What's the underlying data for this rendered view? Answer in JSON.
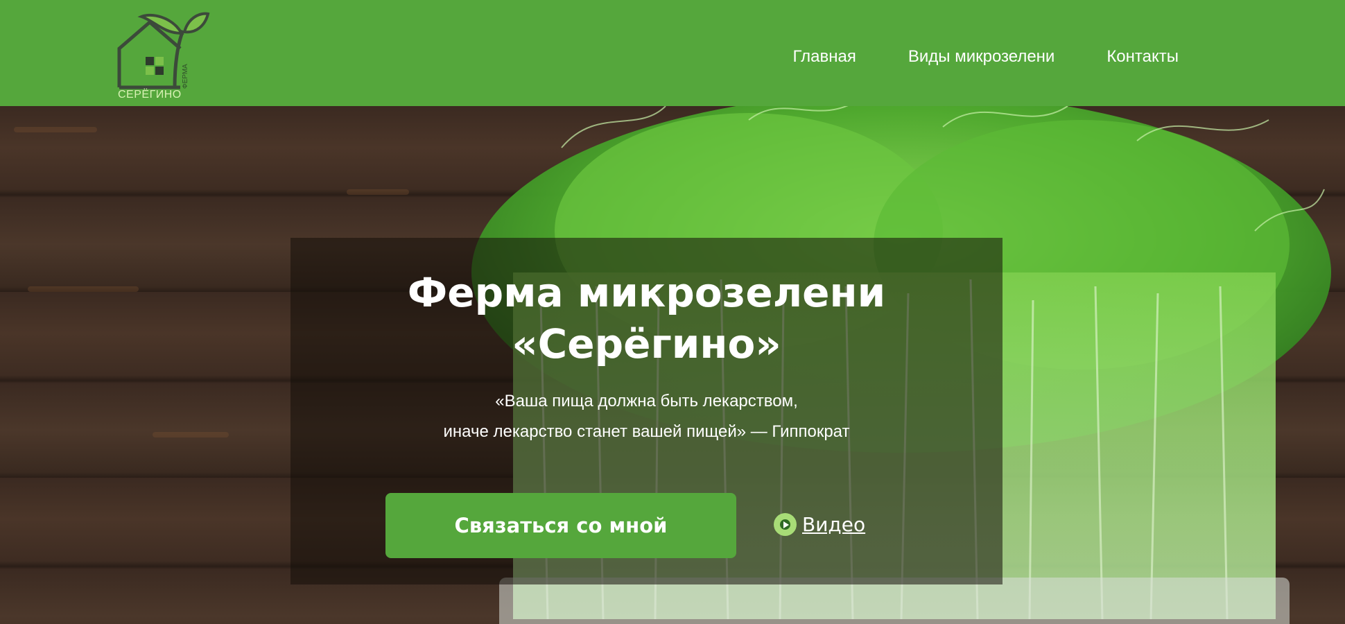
{
  "brand": {
    "name": "СЕРЁГИНО",
    "tagline": "ФЕРМА",
    "colors": {
      "primary": "#55a73c",
      "logo_dark": "#3c4a3a",
      "leaf": "#7cc04a"
    }
  },
  "nav": {
    "items": [
      {
        "label": "Главная"
      },
      {
        "label": "Виды микрозелени"
      },
      {
        "label": "Контакты"
      }
    ]
  },
  "hero": {
    "title_line1": "Ферма микрозелени",
    "title_line2": "«Серёгино»",
    "quote_line1": "«Ваша пища должна быть лекарством,",
    "quote_line2": "иначе лекарство станет вашей пищей» — Гиппократ",
    "cta_label": "Связаться со мной",
    "video_label": "Видео",
    "video_icon": "play-circle-icon"
  }
}
